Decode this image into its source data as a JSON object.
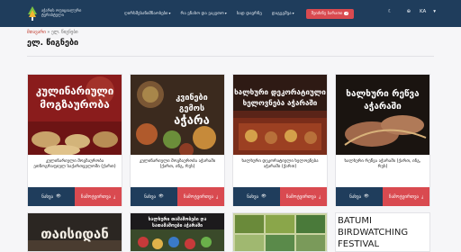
{
  "nav": {
    "logo_text_1": "აჭარის ოფიციალური",
    "logo_text_2": "ტურისტული",
    "menu": [
      {
        "label": "ღირსშესანიშნაობები",
        "has_chevron": true
      },
      {
        "label": "რა ვნახო და ვაკეთო",
        "has_chevron": true
      },
      {
        "label": "სად დავრჩე",
        "has_chevron": false
      },
      {
        "label": "დაგეგმვა",
        "has_chevron": true
      }
    ],
    "cta_label": "შეიძინე ბარათი",
    "cta_badge": "↗",
    "theme_icon": "☾",
    "lang": "KA",
    "lang_chevron": "▾"
  },
  "breadcrumb": {
    "home": "მთავარი",
    "sep": "»",
    "current": "ელ. წიგნები"
  },
  "page_title": "ელ. წიგნები",
  "cards": [
    {
      "image_text": [
        "კულინარიული",
        "მოგზაურობა"
      ],
      "title": "კულინარიული მოგზაურობა ეთნოგრაფიულ საქართველოში (ქართ)",
      "view": "ნახვა",
      "download": "ჩამოტვირთვა"
    },
    {
      "image_text": [
        "კვინები",
        "გემოს",
        "აჭარა"
      ],
      "title": "კულინარიული მოგზაურობა აჭარაში (ქართ, ინგ, რუს)",
      "view": "ნახვა",
      "download": "ჩამოტვირთვა"
    },
    {
      "image_text": [
        "ხალხური დეკორატიული",
        "ხელოვნება აჭარაში"
      ],
      "title": "ხალხური დეკორატიული ხელოვნება აჭარაში (ქართ)",
      "view": "ნახვა",
      "download": "ჩამოტვირთვა"
    },
    {
      "image_text": [
        "ხალხური რეწვა",
        "აჭარაში"
      ],
      "title": "ხალხური რეწვა აჭარაში (ქართ, ინგ, რუს)",
      "view": "ნახვა",
      "download": "ჩამოტვირთვა"
    }
  ],
  "row2": [
    {
      "image_text": [
        "თაისიდან"
      ]
    },
    {
      "image_text": [
        "ხალხური თამაშობები და",
        "სათამაშოები აჭარაში"
      ]
    },
    {
      "image_text": []
    },
    {
      "image_text": [
        "BATUMI",
        "BIRDWATCHING",
        "FESTIVAL"
      ]
    }
  ]
}
